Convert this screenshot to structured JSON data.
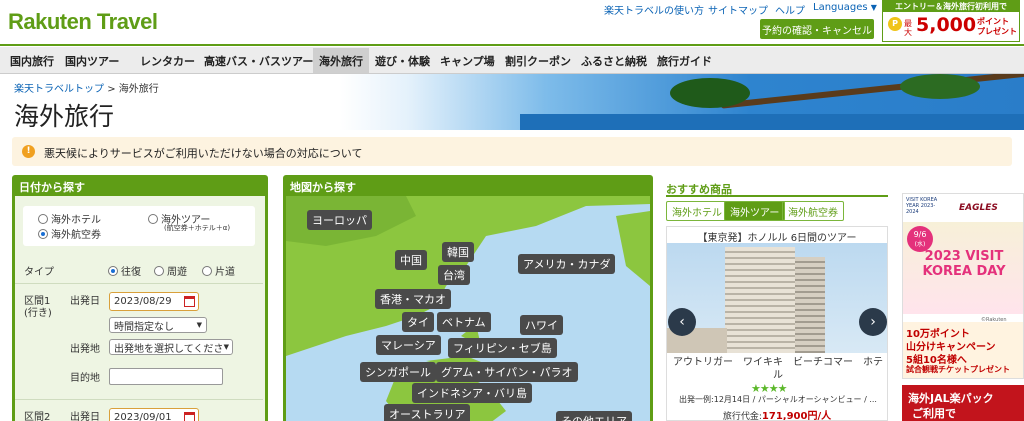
{
  "logo": "Rakuten Travel",
  "top_links": [
    "楽天トラベルの使い方",
    "サイトマップ",
    "ヘルプ"
  ],
  "languages": "Languages",
  "reservation_button": "予約の確認・キャンセル",
  "promo_banner": {
    "line1": "エントリー＆海外旅行初利用で",
    "max": "最大",
    "amount": "5,000",
    "unit1": "ポイント",
    "unit2": "プレゼント"
  },
  "nav": [
    "国内旅行",
    "国内ツアー",
    "レンタカー",
    "高速バス・バスツアー",
    "海外旅行",
    "遊び・体験",
    "キャンプ場",
    "割引クーポン",
    "ふるさと納税",
    "旅行ガイド"
  ],
  "breadcrumb": {
    "home": "楽天トラベルトップ",
    "sep": ">",
    "current": "海外旅行"
  },
  "page_title": "海外旅行",
  "notice": "悪天候によりサービスがご利用いただけない場合の対応について",
  "date_search": {
    "title": "日付から探す",
    "opt_hotel": "海外ホテル",
    "opt_tour": "海外ツアー",
    "opt_tour_note": "(航空券＋ホテル＋α)",
    "opt_air": "海外航空券",
    "type_label": "タイプ",
    "trip_round": "往復",
    "trip_circle": "周遊",
    "trip_oneway": "片道",
    "seg1_label1": "区間1",
    "seg1_label2": "(行き)",
    "depart_date_label": "出発日",
    "depart_date": "2023/08/29",
    "time_select": "時間指定なし",
    "origin_label": "出発地",
    "origin_select": "出発地を選択してくださ",
    "dest_label": "目的地",
    "seg2_label": "区間2",
    "depart_date_label2": "出発日",
    "depart_date2": "2023/09/01"
  },
  "map_search": {
    "title": "地図から探す",
    "labels": [
      "ヨーロッパ",
      "韓国",
      "中国",
      "台湾",
      "アメリカ・カナダ",
      "香港・マカオ",
      "タイ",
      "ベトナム",
      "ハワイ",
      "マレーシア",
      "フィリピン・セブ島",
      "シンガポール",
      "グアム・サイパン・パラオ",
      "インドネシア・バリ島",
      "オーストラリア",
      "その他エリア"
    ]
  },
  "recommend": {
    "title": "おすすめ商品",
    "tabs": [
      "海外ホテル",
      "海外ツアー",
      "海外航空券"
    ],
    "card_title": "【東京発】ホノルル 6日間のツアー",
    "hotel_name": "アウトリガー　ワイキキ　ビーチコマー　ホテル",
    "stars": 4,
    "detail": "出発一例:12月14日 / パーシャルオーシャンビュー / ...",
    "price_label": "旅行代金:",
    "price": "171,900円/人"
  },
  "ad1": {
    "top": "VISIT KOREA YEAR 2023-2024",
    "team": "EAGLES",
    "date": "9/6",
    "date_sub": "(水)",
    "headline": "2023 VISIT KOREA DAY",
    "copyright": "©Rakuten Eagles",
    "body1": "10万ポイント",
    "body2": "山分けキャンペーン",
    "body3": "5組10名様へ",
    "body4": "試合観戦チケットプレゼント"
  },
  "ad2": {
    "line1": "海外JAL楽パック",
    "line2": "ご利用で"
  },
  "colors": {
    "green": "#5f9d16",
    "nav_bg": "#e6e6e6",
    "notice_bg": "#fdf3e0",
    "map_sea": "#b6daf2",
    "map_land": "#8cc63f",
    "price": "#c00000"
  }
}
